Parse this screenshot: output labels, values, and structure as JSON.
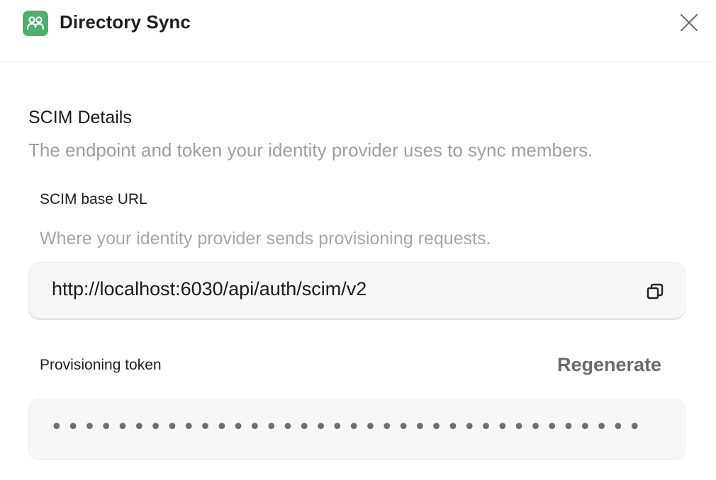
{
  "header": {
    "title": "Directory Sync",
    "app_icon": "users-group-icon",
    "close_icon": "close-icon",
    "accent": "#4caf6e"
  },
  "section": {
    "title": "SCIM Details",
    "description": "The endpoint and token your identity provider uses to sync members."
  },
  "base_url": {
    "label": "SCIM base URL",
    "help": "Where your identity provider sends provisioning requests.",
    "value": "http://localhost:6030/api/auth/scim/v2",
    "copy_icon": "copy-icon"
  },
  "token": {
    "label": "Provisioning token",
    "regenerate_label": "Regenerate",
    "masked_value": "••••••••••••••••••••••••••••••••••••"
  }
}
